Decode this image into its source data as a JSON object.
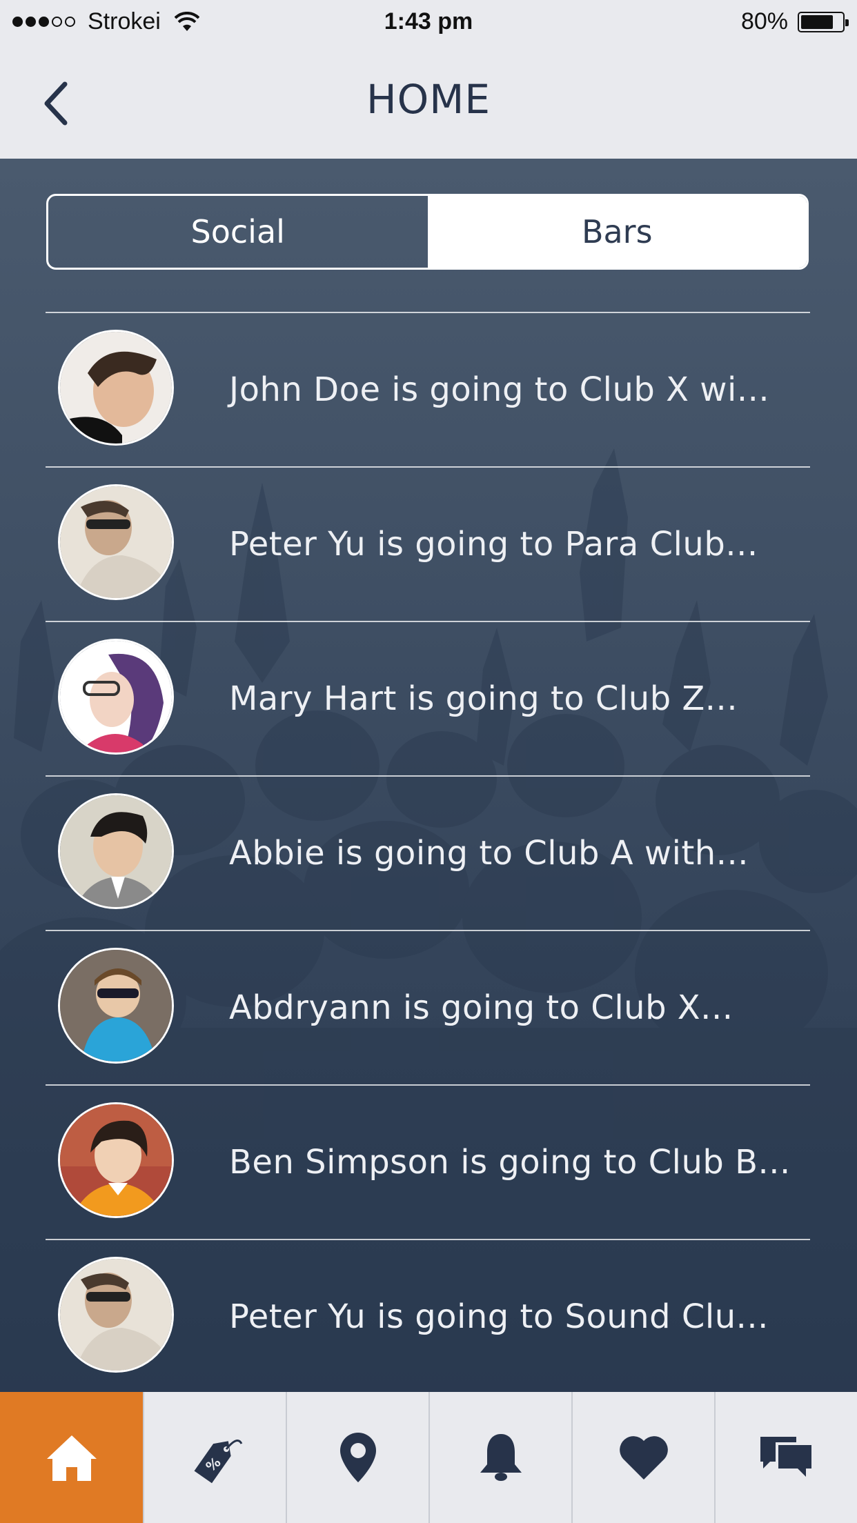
{
  "status_bar": {
    "carrier": "Strokei",
    "time": "1:43 pm",
    "battery": "80%",
    "battery_level": 0.8,
    "signal_bars": 3,
    "signal_total": 5
  },
  "nav": {
    "title": "HOME",
    "back_icon": "chevron-left-icon"
  },
  "segments": {
    "social": "Social",
    "bars": "Bars",
    "selected": "social"
  },
  "feed": [
    {
      "text": "John Doe is going to Club X wi..."
    },
    {
      "text": "Peter Yu is going to Para Club..."
    },
    {
      "text": "Mary Hart is going to Club Z..."
    },
    {
      "text": "Abbie is going to Club A with..."
    },
    {
      "text": "Abdryann is going to Club X..."
    },
    {
      "text": "Ben Simpson is going to Club B..."
    },
    {
      "text": "Peter Yu is going to Sound Clu..."
    }
  ],
  "tabs": [
    {
      "icon": "home-icon",
      "active": true
    },
    {
      "icon": "discount-tag-icon",
      "active": false
    },
    {
      "icon": "location-pin-icon",
      "active": false
    },
    {
      "icon": "bell-icon",
      "active": false
    },
    {
      "icon": "heart-icon",
      "active": false
    },
    {
      "icon": "chat-bubbles-icon",
      "active": false
    }
  ],
  "colors": {
    "accent": "#e07a24",
    "navy": "#27334a",
    "bar_bg": "#e9eaee",
    "main_bg": "#3f4f64"
  }
}
